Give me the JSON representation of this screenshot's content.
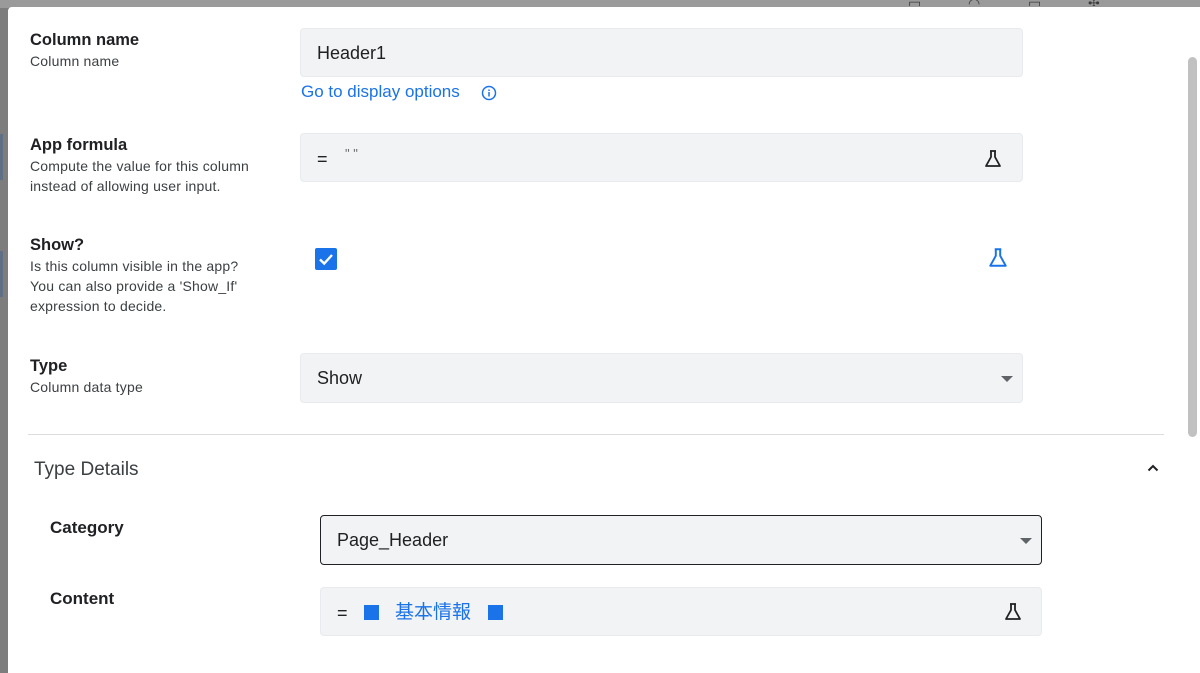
{
  "column_name": {
    "title": "Column name",
    "description": "Column name",
    "value": "Header1",
    "display_link": "Go to display options"
  },
  "app_formula": {
    "title": "App formula",
    "description_line1": "Compute the value for this column",
    "description_line2": "instead of allowing user input.",
    "equals": "=",
    "value": "\" \""
  },
  "show": {
    "title": "Show?",
    "description_line1": "Is this column visible in the app?",
    "description_line2": "You can also provide a 'Show_If'",
    "description_line3": "expression to decide.",
    "checked": true
  },
  "type": {
    "title": "Type",
    "description": "Column data type",
    "selected": "Show"
  },
  "type_details": {
    "title": "Type Details",
    "category_label": "Category",
    "category_value": "Page_Header",
    "content_label": "Content",
    "content_equals": "=",
    "content_text": "基本情報"
  },
  "colors": {
    "accent": "#1a73e8",
    "field_bg": "#f1f3f4",
    "text": "#202124"
  },
  "icons": [
    "info-icon",
    "beaker-icon",
    "checkmark-icon",
    "dropdown-arrow-icon",
    "chevron-up-icon"
  ]
}
